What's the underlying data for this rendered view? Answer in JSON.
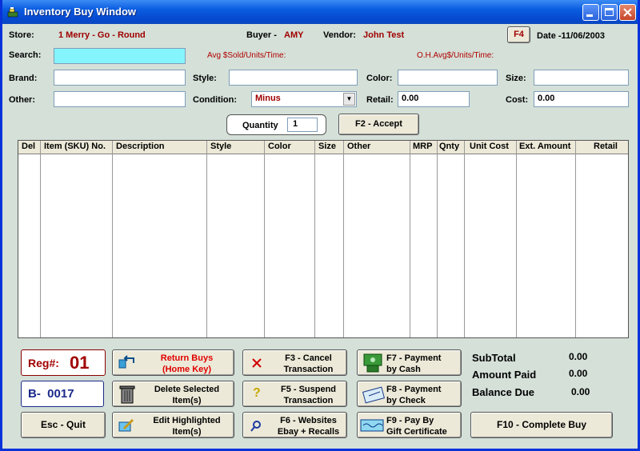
{
  "window": {
    "title": "Inventory Buy Window"
  },
  "header": {
    "store_label": "Store:",
    "store_value": "1   Merry - Go - Round",
    "buyer_label": "Buyer -",
    "buyer_value": "AMY",
    "vendor_label": "Vendor:",
    "vendor_value": "John Test",
    "f4_label": "F4",
    "date_label": "Date -11/06/2003"
  },
  "search": {
    "label": "Search:",
    "value": "",
    "avg_sold": "Avg $Sold/Units/Time:",
    "oh_avg": "O.H.Avg$/Units/Time:"
  },
  "fields": {
    "brand_label": "Brand:",
    "brand_value": "",
    "style_label": "Style:",
    "style_value": "",
    "color_label": "Color:",
    "color_value": "",
    "size_label": "Size:",
    "size_value": "",
    "other_label": "Other:",
    "other_value": "",
    "condition_label": "Condition:",
    "condition_value": "Minus",
    "retail_label": "Retail:",
    "retail_value": "0.00",
    "cost_label": "Cost:",
    "cost_value": "0.00"
  },
  "quantity": {
    "label": "Quantity",
    "value": "1",
    "accept_label": "F2 - Accept"
  },
  "grid": {
    "columns": [
      "Del",
      "Item (SKU) No.",
      "Description",
      "Style",
      "Color",
      "Size",
      "Other",
      "MRP",
      "Qnty",
      "Unit Cost",
      "Ext. Amount",
      "Retail"
    ]
  },
  "register": {
    "reg_label": "Reg#:",
    "reg_value": "01",
    "batch": "B-  0017"
  },
  "buttons": {
    "quit": "Esc -  Quit",
    "return_1": "Return Buys",
    "return_2": "(Home Key)",
    "delete_1": "Delete Selected",
    "delete_2": "Item(s)",
    "edit_1": "Edit Highlighted",
    "edit_2": "Item(s)",
    "cancel_1": "F3 - Cancel",
    "cancel_2": "Transaction",
    "suspend_1": "F5 - Suspend",
    "suspend_2": "Transaction",
    "websites_1": "F6 - Websites",
    "websites_2": "Ebay + Recalls",
    "cash_1": "F7 - Payment",
    "cash_2": "by Cash",
    "check_1": "F8 - Payment",
    "check_2": "by Check",
    "gift_1": "F9 - Pay By",
    "gift_2": "Gift Certificate",
    "complete": "F10 - Complete Buy"
  },
  "totals": {
    "subtotal_label": "SubTotal",
    "subtotal_value": "0.00",
    "paid_label": "Amount Paid",
    "paid_value": "0.00",
    "balance_label": "Balance Due",
    "balance_value": "0.00"
  },
  "colors": {
    "window_bg": "#d4e0d8",
    "accent_red": "#a00000",
    "search_bg": "#84f5fd",
    "titlebar": "#0a5ce0"
  }
}
